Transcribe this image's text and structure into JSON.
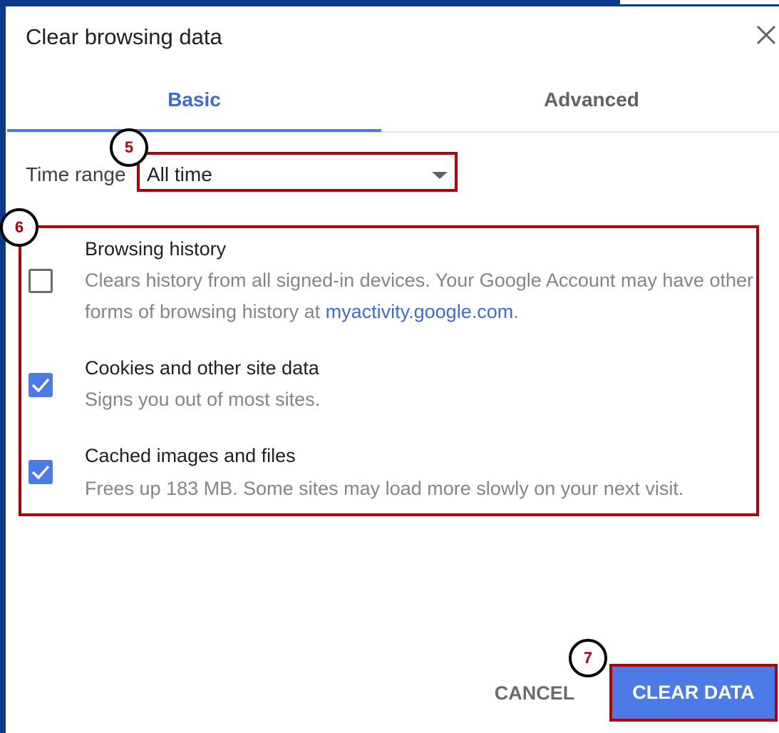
{
  "dialog": {
    "title": "Clear browsing data",
    "close_icon": "close-icon"
  },
  "tabs": [
    {
      "label": "Basic",
      "active": true
    },
    {
      "label": "Advanced",
      "active": false
    }
  ],
  "time_range": {
    "label": "Time range",
    "value": "All time"
  },
  "callouts": {
    "five": "5",
    "six": "6",
    "seven": "7"
  },
  "options": [
    {
      "title": "Browsing history",
      "desc_prefix": "Clears history from all signed-in devices. Your Google Account may have other forms of browsing history at ",
      "link": "myactivity.google.com",
      "desc_suffix": ".",
      "checked": false
    },
    {
      "title": "Cookies and other site data",
      "desc": "Signs you out of most sites.",
      "checked": true
    },
    {
      "title": "Cached images and files",
      "desc": "Frees up 183 MB. Some sites may load more slowly on your next visit.",
      "checked": true
    }
  ],
  "buttons": {
    "cancel": "CANCEL",
    "clear": "CLEAR DATA"
  },
  "colors": {
    "accent": "#4c7be8",
    "highlight": "#b0000c",
    "frame": "#0b3a8a"
  }
}
